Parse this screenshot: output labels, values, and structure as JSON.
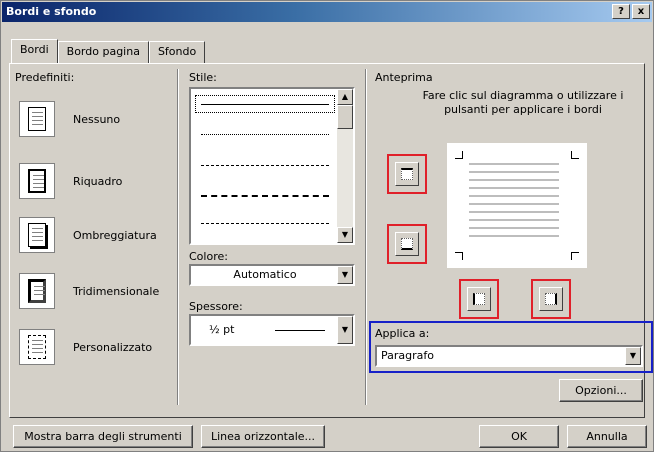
{
  "window": {
    "title": "Bordi e sfondo",
    "help_button": "?",
    "close_button": "x"
  },
  "tabs": [
    {
      "label": "Bordi"
    },
    {
      "label": "Bordo pagina"
    },
    {
      "label": "Sfondo"
    }
  ],
  "presets": {
    "label": "Predefiniti:",
    "items": [
      {
        "label": "Nessuno",
        "icon": "border-none-icon"
      },
      {
        "label": "Riquadro",
        "icon": "border-box-icon"
      },
      {
        "label": "Ombreggiatura",
        "icon": "border-shadow-icon"
      },
      {
        "label": "Tridimensionale",
        "icon": "border-3d-icon"
      },
      {
        "label": "Personalizzato",
        "icon": "border-custom-icon"
      }
    ]
  },
  "style": {
    "label": "Stile:",
    "colore_label": "Colore:",
    "colore_value": "Automatico",
    "spessore_label": "Spessore:",
    "spessore_value": "½ pt"
  },
  "preview": {
    "label": "Anteprima",
    "hint": "Fare clic sul diagramma o utilizzare i pulsanti per applicare i bordi"
  },
  "apply": {
    "label": "Applica a:",
    "value": "Paragrafo"
  },
  "buttons": {
    "options": "Opzioni...",
    "toolbar": "Mostra barra degli strumenti",
    "horizontal_line": "Linea orizzontale...",
    "ok": "OK",
    "cancel": "Annulla"
  },
  "colors": {
    "annotation_red": "#e0202a",
    "annotation_blue": "#1620c8",
    "dialog_bg": "#d4d0c8"
  }
}
